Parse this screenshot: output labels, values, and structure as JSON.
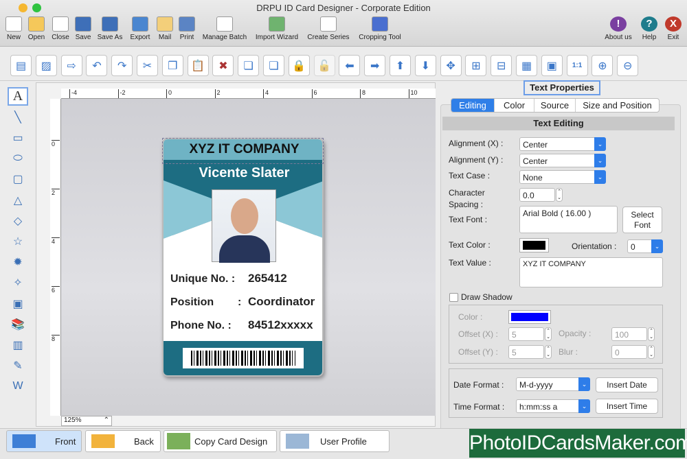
{
  "window": {
    "title": "DRPU ID Card Designer - Corporate Edition"
  },
  "toolbar": {
    "items": [
      "New",
      "Open",
      "Close",
      "Save",
      "Save As",
      "Export",
      "Mail",
      "Print",
      "Manage Batch",
      "Import Wizard",
      "Create Series",
      "Cropping Tool"
    ],
    "right": [
      "About us",
      "Help",
      "Exit"
    ]
  },
  "toolbar2": {
    "icons": [
      "new-doc-icon",
      "image-icon",
      "export-icon",
      "undo-icon",
      "redo-icon",
      "cut-icon",
      "copy-icon",
      "paste-icon",
      "delete-icon",
      "send-back-icon",
      "bring-front-icon",
      "lock-icon",
      "unlock-icon",
      "arrow-left-icon",
      "arrow-right-icon",
      "arrow-up-icon",
      "arrow-down-icon",
      "center-icon",
      "align-vertical-icon",
      "align-horizontal-icon",
      "grid-icon",
      "film-icon",
      "actual-size-icon",
      "zoom-in-icon",
      "zoom-out-icon"
    ],
    "glyphs": [
      "▤",
      "▨",
      "⇨",
      "↶",
      "↷",
      "✂",
      "❐",
      "📋",
      "✖",
      "❏",
      "❏",
      "🔒",
      "🔓",
      "⬅",
      "➡",
      "⬆",
      "⬇",
      "✥",
      "⊞",
      "⊟",
      "▦",
      "▣",
      "1:1",
      "⊕",
      "⊖"
    ]
  },
  "tools": [
    "A",
    "╲",
    "▭",
    "⬭",
    "▢",
    "△",
    "◇",
    "☆",
    "✹",
    "✧",
    "▣",
    "📚",
    "▥",
    "✎",
    "W"
  ],
  "ruler": {
    "top": [
      "-4",
      "-2",
      "0",
      "2",
      "4",
      "6",
      "8",
      "10"
    ],
    "left": [
      "0",
      "2",
      "4",
      "6",
      "8"
    ]
  },
  "zoom": "125%",
  "card": {
    "company": "XYZ IT COMPANY",
    "name": "Vicente Slater",
    "fields": [
      {
        "label": "Unique No. :",
        "value": "265412"
      },
      {
        "label": "Position",
        "colon": ":",
        "value": "Coordinator"
      },
      {
        "label": "Phone No.  :",
        "value": "84512xxxxx"
      }
    ],
    "colors": {
      "header": "#6fb3c4",
      "band": "#1d6d82"
    }
  },
  "panel": {
    "title": "Text Properties",
    "tabs": [
      "Editing",
      "Color",
      "Source",
      "Size and Position"
    ],
    "section": "Text Editing",
    "align_x_label": "Alignment (X) :",
    "align_x": "Center",
    "align_y_label": "Alignment (Y) :",
    "align_y": "Center",
    "text_case_label": "Text Case :",
    "text_case": "None",
    "char_spacing_label1": "Character",
    "char_spacing_label2": "Spacing :",
    "char_spacing": "0.0",
    "font_label": "Text Font :",
    "font": "Arial Bold ( 16.00 )",
    "select_font1": "Select",
    "select_font2": "Font",
    "color_label": "Text Color :",
    "text_color": "#000000",
    "orientation_label": "Orientation :",
    "orientation": "0",
    "value_label": "Text Value :",
    "value": "XYZ IT COMPANY",
    "shadow_label": "Draw Shadow",
    "shadow_checked": false,
    "shadow_color_label": "Color :",
    "shadow_color": "#0000ff",
    "offset_x_label": "Offset (X) :",
    "offset_x": "5",
    "offset_y_label": "Offset (Y) :",
    "offset_y": "5",
    "opacity_label": "Opacity :",
    "opacity": "100",
    "blur_label": "Blur :",
    "blur": "0",
    "date_label": "Date Format :",
    "date": "M-d-yyyy",
    "insert_date": "Insert Date",
    "time_label": "Time Format :",
    "time": "h:mm:ss a",
    "insert_time": "Insert Time"
  },
  "bottom": {
    "front": "Front",
    "back": "Back",
    "copy": "Copy Card Design",
    "profile": "User Profile"
  },
  "watermark": "PhotoIDCardsMaker.com"
}
